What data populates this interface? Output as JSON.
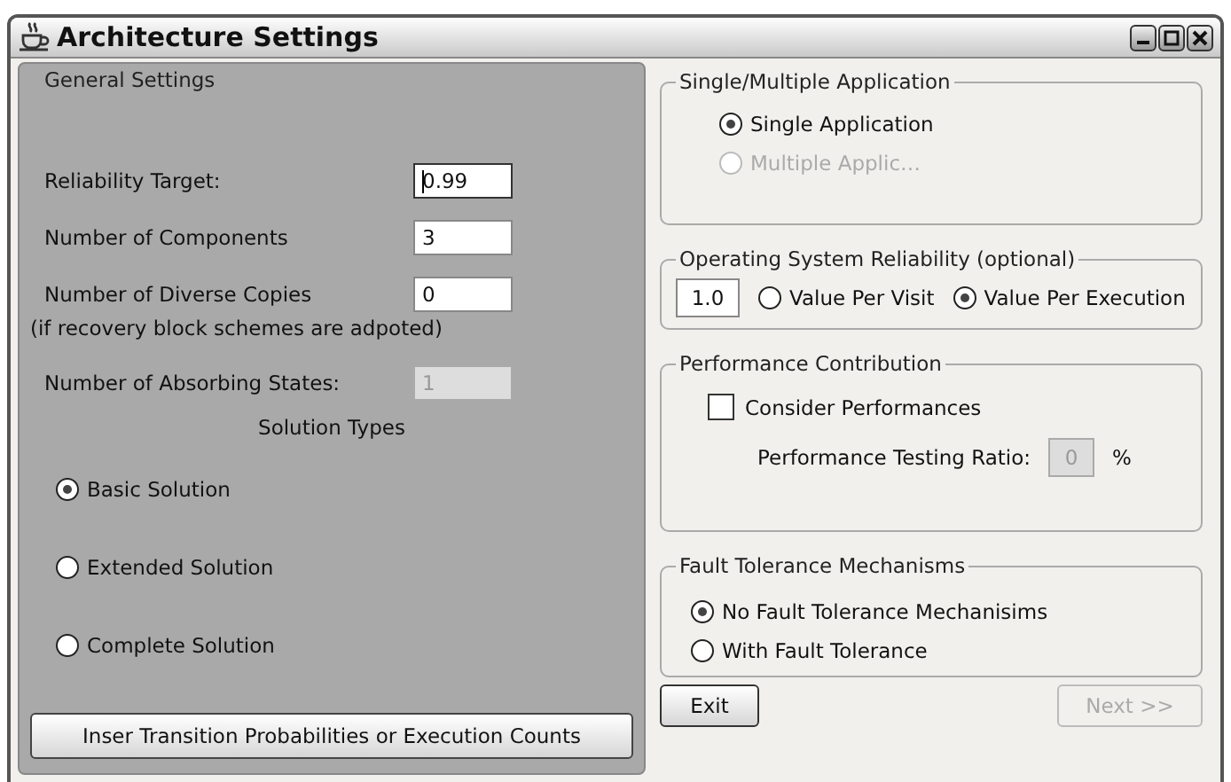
{
  "window": {
    "title": "Architecture Settings"
  },
  "general_settings": {
    "title": "General Settings",
    "fields": [
      {
        "label": "Reliability Target:",
        "value": "0.99",
        "focused": true,
        "disabled": false
      },
      {
        "label": "Number of Components",
        "value": "3",
        "focused": false,
        "disabled": false
      },
      {
        "label": "Number of Diverse Copies",
        "value": "0",
        "focused": false,
        "disabled": false,
        "note": "(if recovery block schemes are adpoted)"
      },
      {
        "label": "Number of Absorbing States:",
        "value": "1",
        "focused": false,
        "disabled": true
      }
    ],
    "solution_types": {
      "title": "Solution Types",
      "options": [
        {
          "label": "Basic Solution",
          "selected": true
        },
        {
          "label": "Extended Solution",
          "selected": false
        },
        {
          "label": "Complete Solution",
          "selected": false
        }
      ]
    },
    "button": "Inser Transition Probabilities or Execution Counts"
  },
  "application": {
    "title": "Single/Multiple Application",
    "options": [
      {
        "label": "Single Application",
        "selected": true,
        "disabled": false
      },
      {
        "label": "Multiple Applic…",
        "selected": false,
        "disabled": true
      }
    ]
  },
  "os_reliability": {
    "title": "Operating System Reliability (optional)",
    "value": "1.0",
    "options": [
      {
        "label": "Value Per Visit",
        "selected": false
      },
      {
        "label": "Value Per Execution",
        "selected": true
      }
    ]
  },
  "performance": {
    "title": "Performance Contribution",
    "checkbox": {
      "label": "Consider Performances",
      "checked": false
    },
    "ratio": {
      "label": "Performance Testing Ratio:",
      "value": "0",
      "disabled": true,
      "unit": "%"
    }
  },
  "fault_tolerance": {
    "title": "Fault Tolerance Mechanisms",
    "options": [
      {
        "label": "No Fault Tolerance Mechanisims",
        "selected": true
      },
      {
        "label": "With Fault Tolerance",
        "selected": false
      }
    ]
  },
  "buttons": [
    {
      "label": "Exit",
      "disabled": false
    },
    {
      "label": "Next >>",
      "disabled": true
    }
  ]
}
